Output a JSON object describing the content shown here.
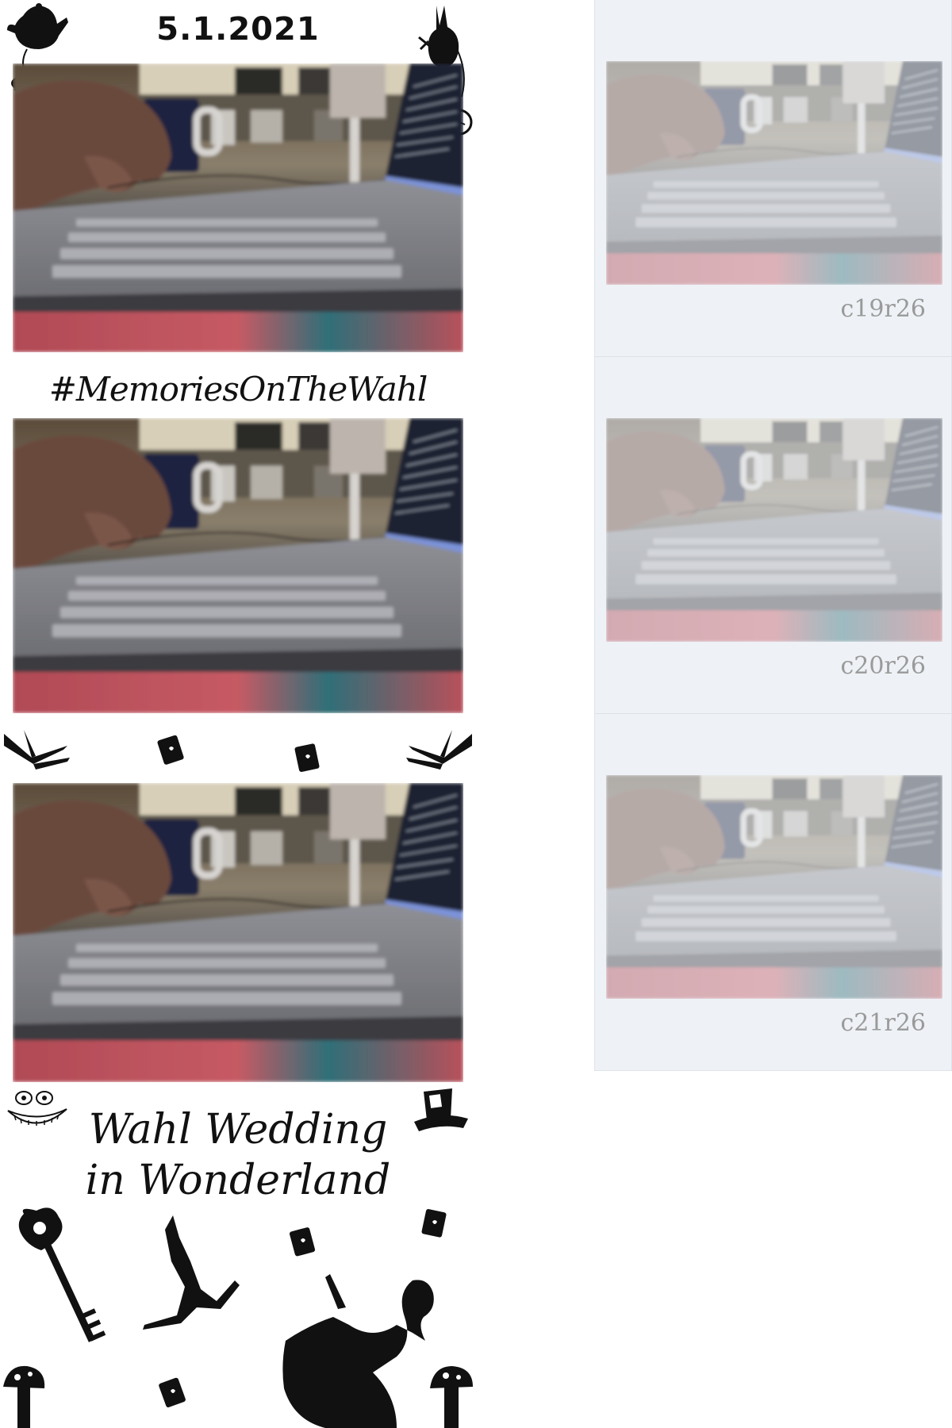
{
  "strip": {
    "date": "5.1.2021",
    "hashtag": "#MemoriesOnTheWahl",
    "title_line1": "Wahl Wedding",
    "title_line2": "in Wonderland"
  },
  "thumbnails": [
    {
      "label": "c19r26"
    },
    {
      "label": "c20r26"
    },
    {
      "label": "c21r26"
    }
  ],
  "icons": {
    "teapot": "teapot-icon",
    "rabbit": "white-rabbit-icon",
    "pocket_watch": "pocket-watch-icon",
    "card": "playing-card-icon",
    "book": "book-icon",
    "cheshire": "cheshire-cat-icon",
    "hat": "mad-hatter-hat-icon",
    "key": "key-icon",
    "mushroom": "mushroom-icon"
  }
}
